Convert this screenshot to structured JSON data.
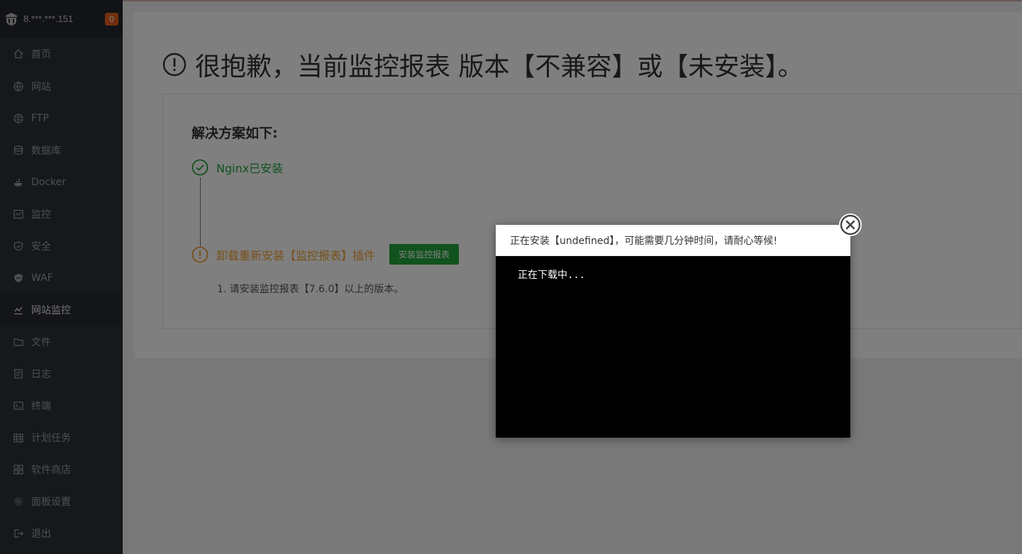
{
  "server": {
    "ip": "8.***.***.151",
    "badge": "0"
  },
  "menu": [
    {
      "label": "首页",
      "icon": "home-icon"
    },
    {
      "label": "网站",
      "icon": "globe-icon"
    },
    {
      "label": "FTP",
      "icon": "ftp-icon"
    },
    {
      "label": "数据库",
      "icon": "database-icon"
    },
    {
      "label": "Docker",
      "icon": "docker-icon"
    },
    {
      "label": "监控",
      "icon": "monitor-icon"
    },
    {
      "label": "安全",
      "icon": "shield-icon"
    },
    {
      "label": "WAF",
      "icon": "waf-icon"
    },
    {
      "label": "网站监控",
      "icon": "site-monitor-icon",
      "active": true
    },
    {
      "label": "文件",
      "icon": "folder-icon"
    },
    {
      "label": "日志",
      "icon": "log-icon"
    },
    {
      "label": "终端",
      "icon": "terminal-icon"
    },
    {
      "label": "计划任务",
      "icon": "calendar-icon"
    },
    {
      "label": "软件商店",
      "icon": "store-icon"
    },
    {
      "label": "面板设置",
      "icon": "gear-icon"
    },
    {
      "label": "退出",
      "icon": "logout-icon"
    }
  ],
  "page": {
    "title": "很抱歉，当前监控报表 版本【不兼容】或【未安装】。",
    "solution_heading": "解决方案如下:",
    "step1": "Nginx已安装",
    "step2": "卸载重新安装【监控报表】插件",
    "install_button": "安装监控报表",
    "note": "1. 请安装监控报表【7.6.0】以上的版本。"
  },
  "dialog": {
    "title": "正在安装【undefined】，可能需要几分钟时间，请耐心等候!",
    "log": "正在下载中..."
  },
  "colors": {
    "success": "#20a53a",
    "warning": "#f0a030",
    "sidebar": "#2c3138",
    "badge": "#e65f1f"
  }
}
